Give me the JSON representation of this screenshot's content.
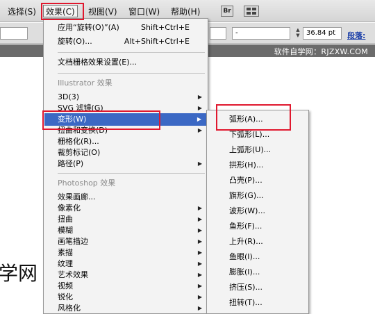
{
  "menubar": {
    "items": [
      {
        "label": "选择(S)"
      },
      {
        "label": "效果(C)"
      },
      {
        "label": "视图(V)"
      },
      {
        "label": "窗口(W)"
      },
      {
        "label": "帮助(H)"
      }
    ],
    "br_icon": "Br",
    "icons": [
      "bridge-icon",
      "arrange-documents-icon"
    ]
  },
  "controlbar": {
    "dash_value": "-",
    "font_size_value": "36.84 pt",
    "paragraph_link": "段落:"
  },
  "watermark": "软件自学网：RJZXW.COM",
  "canvas": {
    "text": "学网"
  },
  "effect_menu": {
    "rotate_label": "应用“旋转(O)”(A)",
    "rotate_shortcut": "Shift+Ctrl+E",
    "rotate2_label": "旋转(O)...",
    "rotate2_shortcut": "Alt+Shift+Ctrl+E",
    "raster_settings_label": "文档栅格效果设置(E)...",
    "illustrator_header": "Illustrator 效果",
    "illustrator_items": [
      {
        "label": "3D(3)"
      },
      {
        "label": "SVG 滤镜(G)"
      },
      {
        "label": "变形(W)"
      },
      {
        "label": "扭曲和变换(D)"
      },
      {
        "label": "栅格化(R)..."
      },
      {
        "label": "裁剪标记(O)"
      },
      {
        "label": "路径(P)"
      }
    ],
    "photoshop_header": "Photoshop 效果",
    "photoshop_items": [
      {
        "label": "效果画廊..."
      },
      {
        "label": "像素化"
      },
      {
        "label": "扭曲"
      },
      {
        "label": "模糊"
      },
      {
        "label": "画笔描边"
      },
      {
        "label": "素描"
      },
      {
        "label": "纹理"
      },
      {
        "label": "艺术效果"
      },
      {
        "label": "视频"
      },
      {
        "label": "锐化"
      },
      {
        "label": "风格化"
      }
    ]
  },
  "warp_submenu": {
    "items": [
      {
        "label": "弧形(A)..."
      },
      {
        "label": "下弧形(L)..."
      },
      {
        "label": "上弧形(U)..."
      },
      {
        "label": "拱形(H)..."
      },
      {
        "label": "凸壳(P)..."
      },
      {
        "label": "旗形(G)..."
      },
      {
        "label": "波形(W)..."
      },
      {
        "label": "鱼形(F)..."
      },
      {
        "label": "上升(R)..."
      },
      {
        "label": "鱼眼(I)..."
      },
      {
        "label": "膨胀(I)..."
      },
      {
        "label": "挤压(S)..."
      },
      {
        "label": "扭转(T)..."
      }
    ]
  },
  "colors": {
    "highlight_box": "#e0182e",
    "selection": "#3b68c4",
    "menubar": "#dcdcdc"
  }
}
